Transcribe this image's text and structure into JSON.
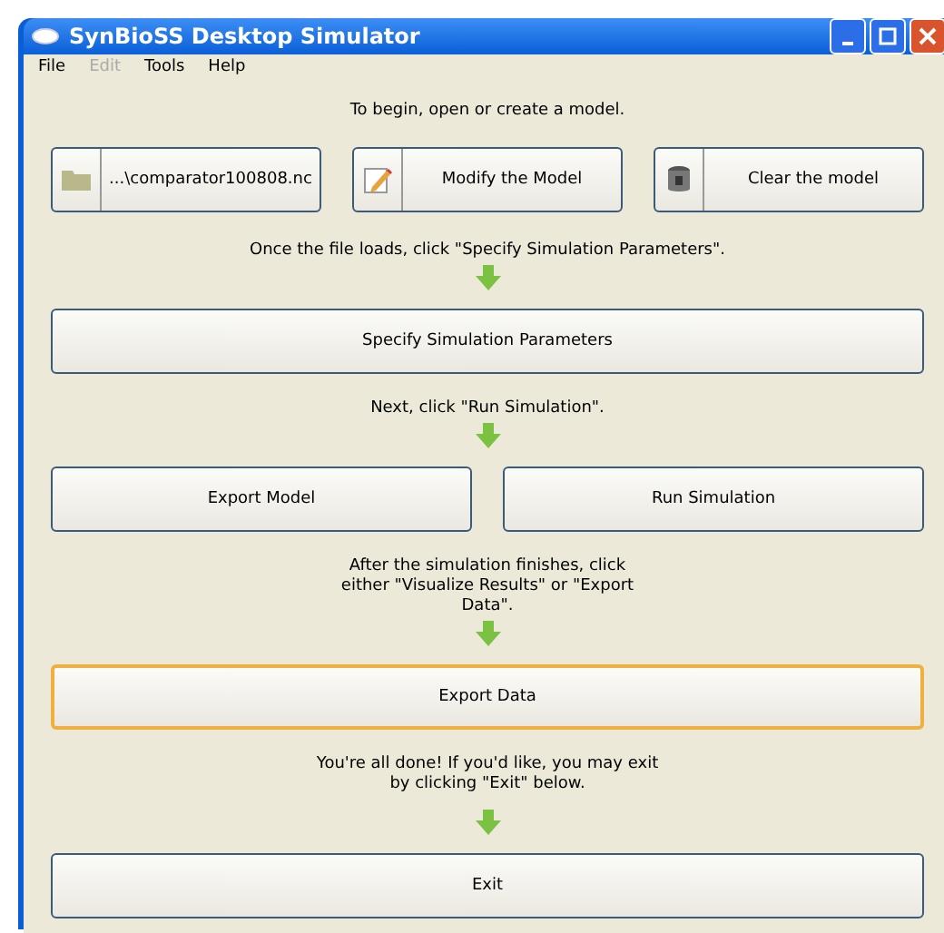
{
  "window": {
    "title": "SynBioSS Desktop Simulator"
  },
  "menu": [
    {
      "label": "File",
      "disabled": false
    },
    {
      "label": "Edit",
      "disabled": true
    },
    {
      "label": "Tools",
      "disabled": false
    },
    {
      "label": "Help",
      "disabled": false
    }
  ],
  "steps": [
    {
      "kind": "text",
      "text": "To begin, open or create a model."
    },
    {
      "kind": "icon_buttons",
      "buttons": [
        {
          "label": "...\\comparator100808.nc",
          "focused": false
        },
        {
          "label": "Modify the Model",
          "focused": false
        },
        {
          "label": "Clear the model",
          "focused": false
        }
      ]
    },
    {
      "kind": "text",
      "text": "Once the file loads, click \"Specify Simulation Parameters\"."
    },
    {
      "kind": "arrow"
    },
    {
      "kind": "buttons",
      "buttons": [
        {
          "label": "Specify Simulation Parameters",
          "focused": false
        }
      ]
    },
    {
      "kind": "text",
      "text": "Next, click \"Run Simulation\"."
    },
    {
      "kind": "arrow"
    },
    {
      "kind": "buttons",
      "buttons": [
        {
          "label": "Export Model",
          "focused": false
        },
        {
          "label": "Run Simulation",
          "focused": false
        }
      ]
    },
    {
      "kind": "text",
      "text": "After the simulation finishes, click either \"Visualize Results\" or \"Export Data\"."
    },
    {
      "kind": "arrow"
    },
    {
      "kind": "buttons",
      "buttons": [
        {
          "label": "Export Data",
          "focused": true
        }
      ]
    },
    {
      "kind": "text",
      "text": "You're all done! If you'd like, you may exit by clicking \"Exit\" below."
    },
    {
      "kind": "arrow"
    },
    {
      "kind": "buttons",
      "buttons": [
        {
          "label": "Exit",
          "focused": false
        }
      ]
    }
  ]
}
